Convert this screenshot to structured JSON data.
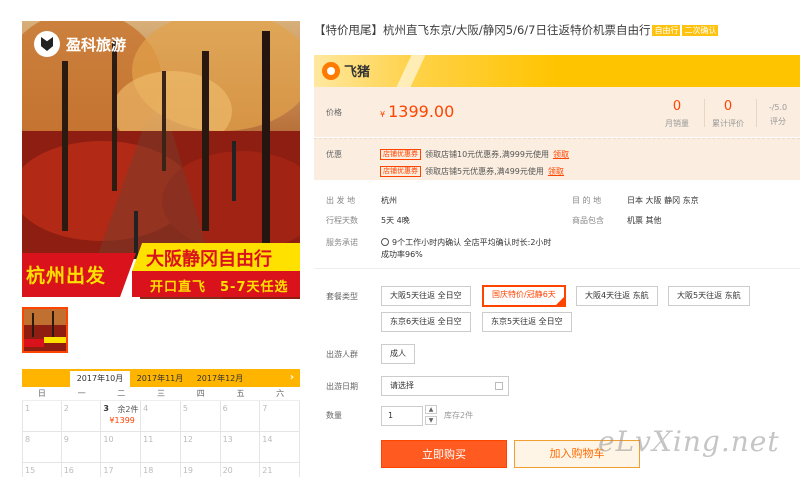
{
  "image": {
    "brand": "盈科旅游",
    "banner_left": "杭州出发",
    "banner_right": "大阪静冈自由行",
    "banner_sub": "开口直飞　5-7天任选"
  },
  "title": {
    "text": "【特价甩尾】杭州直飞东京/大阪/静冈5/6/7日往返特价机票自由行",
    "badges": [
      "自由行",
      "二次确认"
    ]
  },
  "platform": {
    "name": "飞猪"
  },
  "price": {
    "label": "价格",
    "currency": "¥",
    "value": "1399.00",
    "stats": [
      {
        "value": "0",
        "label": "月销量"
      },
      {
        "value": "0",
        "label": "累计评价"
      },
      {
        "value": "-/5.0",
        "label": "评分"
      }
    ]
  },
  "coupons": {
    "label": "优惠",
    "items": [
      {
        "tag": "店铺优惠券",
        "text": "领取店铺10元优惠券,满999元使用",
        "action": "领取"
      },
      {
        "tag": "店铺优惠券",
        "text": "领取店铺5元优惠券,满499元使用",
        "action": "领取"
      }
    ]
  },
  "info": {
    "departure_label": "出 发 地",
    "departure": "杭州",
    "destination_label": "目 的 地",
    "destination": "日本 大阪 静冈 东京",
    "duration_label": "行程天数",
    "duration": "5天 4晚",
    "includes_label": "商品包含",
    "includes": "机票 其他",
    "promise_label": "服务承诺",
    "promise_line1": "9个工作小时内确认 全店平均确认时长:2小时",
    "promise_line2": "成功率96%"
  },
  "package": {
    "label": "套餐类型",
    "options": [
      "大阪5天往返 全日空",
      "国庆特价/冠静6天",
      "大阪4天往返 东航",
      "大阪5天往返 东航",
      "东京6天往返 全日空",
      "东京5天往返 全日空"
    ],
    "selected_index": 1
  },
  "people": {
    "label": "出游人群",
    "option": "成人"
  },
  "travel_date": {
    "label": "出游日期",
    "placeholder": "请选择"
  },
  "quantity": {
    "label": "数量",
    "value": "1",
    "up": "▲",
    "down": "▼",
    "stock": "库存2件"
  },
  "actions": {
    "buy": "立即购买",
    "cart": "加入购物车"
  },
  "calendar": {
    "months": [
      "2017年10月",
      "2017年11月",
      "2017年12月"
    ],
    "active_month_index": 0,
    "next_arrow": "›",
    "weekdays": [
      "日",
      "一",
      "二",
      "三",
      "四",
      "五",
      "六"
    ],
    "days": [
      "1",
      "2",
      "3",
      "4",
      "5",
      "6",
      "7",
      "8",
      "9",
      "10",
      "11",
      "12",
      "13",
      "14",
      "15",
      "16",
      "17",
      "18",
      "19",
      "20",
      "21"
    ],
    "available": {
      "day": "3",
      "remaining": "余2件",
      "price": "¥1399"
    }
  },
  "watermark": "eLvXing.net"
}
